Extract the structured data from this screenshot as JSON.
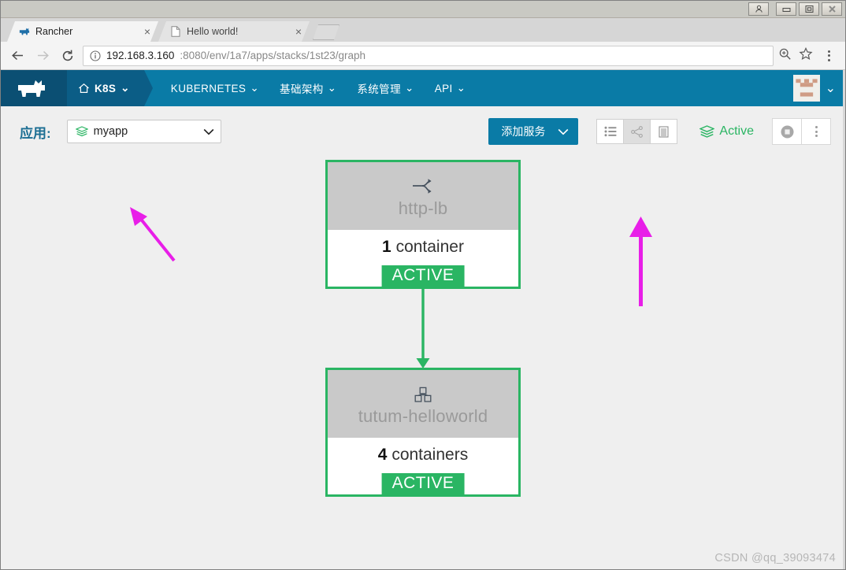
{
  "os": {
    "window_buttons": [
      {
        "name": "user-account-button",
        "icon": "user-icon"
      },
      {
        "name": "minimize-button",
        "icon": "minimize-icon"
      },
      {
        "name": "restore-button",
        "icon": "restore-icon"
      },
      {
        "name": "close-button",
        "icon": "close-icon"
      }
    ]
  },
  "browser": {
    "tabs": [
      {
        "title": "Rancher",
        "favicon": "rancher-cow-icon",
        "active": true,
        "close_label": "×"
      },
      {
        "title": "Hello world!",
        "favicon": "page-icon",
        "active": false,
        "close_label": "×"
      }
    ],
    "new_tab_label": "",
    "nav": {
      "back_label": "←",
      "forward_label": "→",
      "reload_label": "⟳"
    },
    "omnibox": {
      "info_icon": "site-info-icon",
      "url_host": "192.168.3.160",
      "url_rest": ":8080/env/1a7/apps/stacks/1st23/graph",
      "zoom_icon": "zoom-in-icon",
      "bookmark_icon": "star-icon",
      "menu_icon": "three-dot-menu-icon"
    }
  },
  "rancher": {
    "logo_icon": "rancher-cow-logo",
    "environment": {
      "label": "K8S",
      "home_icon": "home-icon",
      "chevron": "⌄"
    },
    "nav_items": [
      {
        "label": "KUBERNETES",
        "chevron": "⌄"
      },
      {
        "label": "基础架构",
        "chevron": "⌄"
      },
      {
        "label": "系统管理",
        "chevron": "⌄"
      },
      {
        "label": "API",
        "chevron": "⌄"
      }
    ],
    "avatar": {
      "icon": "user-avatar-icon",
      "chevron": "⌄"
    },
    "toolbar": {
      "app_label": "应用:",
      "app_select": {
        "value": "myapp",
        "icon": "stack-icon",
        "chevron": "⌄"
      },
      "add_service": {
        "label": "添加服务",
        "chevron": "⌄"
      },
      "view_modes": [
        {
          "name": "list-view",
          "icon": "list-icon",
          "active": false
        },
        {
          "name": "graph-view",
          "icon": "share-graph-icon",
          "active": true
        },
        {
          "name": "config-view",
          "icon": "document-icon",
          "active": false
        }
      ],
      "status": {
        "label": "Active",
        "icon": "stack-icon",
        "color": "#2ab563"
      },
      "actions": [
        {
          "name": "stop-button",
          "icon": "stop-circle-icon"
        },
        {
          "name": "more-actions-button",
          "icon": "three-dot-menu-icon"
        }
      ]
    },
    "graph": {
      "edge_color": "#2ab563",
      "nodes": [
        {
          "name": "http-lb",
          "icon": "load-balancer-icon",
          "count": "1",
          "count_unit": "container",
          "state": "ACTIVE",
          "border_color": "#2ab563"
        },
        {
          "name": "tutum-helloworld",
          "icon": "containers-icon",
          "count": "4",
          "count_unit": "containers",
          "state": "ACTIVE",
          "border_color": "#2ab563"
        }
      ]
    }
  },
  "annotations": {
    "color": "#e81ee8",
    "arrows": [
      {
        "name": "annotation-arrow-app-select",
        "target": "app-select"
      },
      {
        "name": "annotation-arrow-graph-view",
        "target": "graph-view-toggle"
      }
    ]
  },
  "watermark": {
    "text": "CSDN @qq_39093474"
  }
}
